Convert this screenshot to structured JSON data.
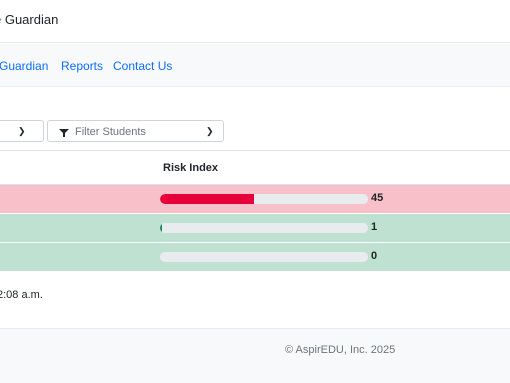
{
  "header": {
    "title": "e Guardian"
  },
  "nav": {
    "links": [
      {
        "label": "Guardian"
      },
      {
        "label": "Reports"
      },
      {
        "label": "Contact Us"
      }
    ]
  },
  "filters": {
    "select1": {
      "chevron": "chevron-down"
    },
    "filter_students": {
      "placeholder": "Filter Students",
      "icon": "filter-icon"
    }
  },
  "table": {
    "header": {
      "risk_index": "Risk Index"
    },
    "rows": [
      {
        "risk_index": 45,
        "display": "45",
        "status": "high",
        "row_color": "#f8c0c9",
        "bar_color": "#e8003a"
      },
      {
        "risk_index": 1,
        "display": "1",
        "status": "low",
        "row_color": "#bfe1d2",
        "bar_color": "#1a8754"
      },
      {
        "risk_index": 0,
        "display": "0",
        "status": "low",
        "row_color": "#bfe1d2",
        "bar_color": "#1a8754"
      }
    ]
  },
  "updated_text": "2:08 a.m.",
  "footer": {
    "copyright": "© AspirEDU, Inc. 2025"
  },
  "colors": {
    "link": "#0d6efd",
    "nav_bg": "#f8f9fa",
    "bar_track": "#e9ecef"
  }
}
